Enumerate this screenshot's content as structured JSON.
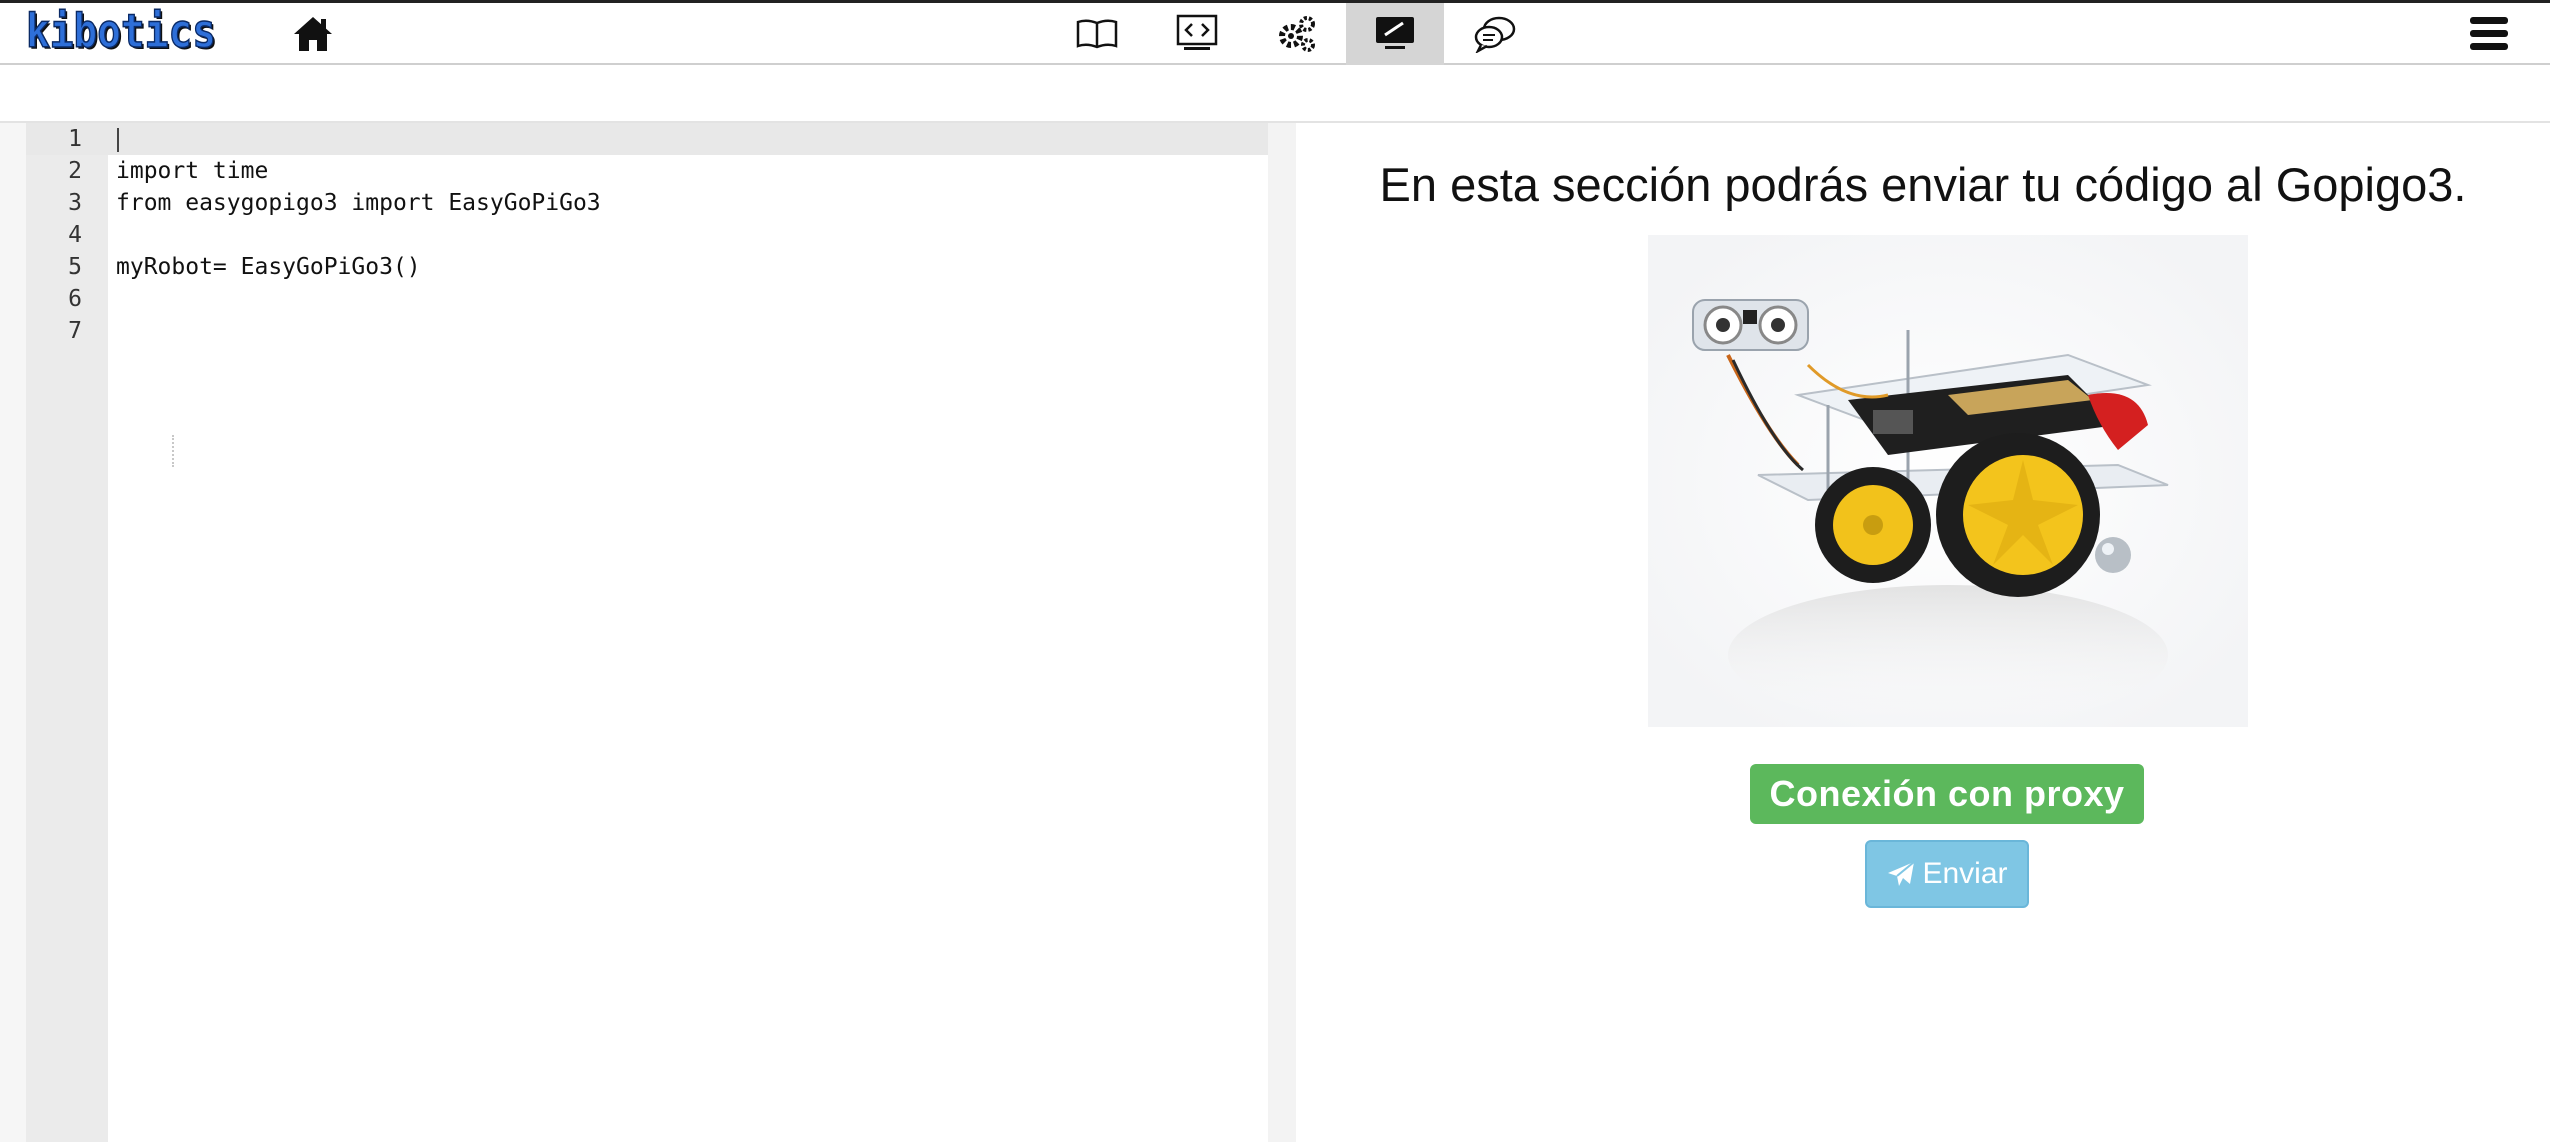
{
  "app": {
    "logo_text": "kibotics"
  },
  "topbar": {
    "home_icon": "home-icon",
    "tools": [
      {
        "icon": "book-icon",
        "active": false
      },
      {
        "icon": "code-screen-icon",
        "active": false
      },
      {
        "icon": "gears-icon",
        "active": false
      },
      {
        "icon": "monitor-icon",
        "active": true
      },
      {
        "icon": "chat-icon",
        "active": false
      }
    ],
    "menu_icon": "hamburger-menu-icon"
  },
  "editor": {
    "line_numbers": [
      "1",
      "2",
      "3",
      "4",
      "5",
      "6",
      "7"
    ],
    "lines": [
      "",
      "import time",
      "from easygopigo3 import EasyGoPiGo3",
      "",
      "myRobot= EasyGoPiGo3()",
      "",
      ""
    ]
  },
  "panel": {
    "title": "En esta sección podrás enviar tu código al Gopigo3.",
    "proxy_button": "Conexión con proxy",
    "send_button": "Enviar",
    "send_icon": "paper-plane-icon"
  },
  "colors": {
    "proxy_button": "#5cb85c",
    "send_button": "#7fc6e4",
    "logo_blue": "#2e6fd8",
    "active_tab": "#d5d5d5"
  }
}
